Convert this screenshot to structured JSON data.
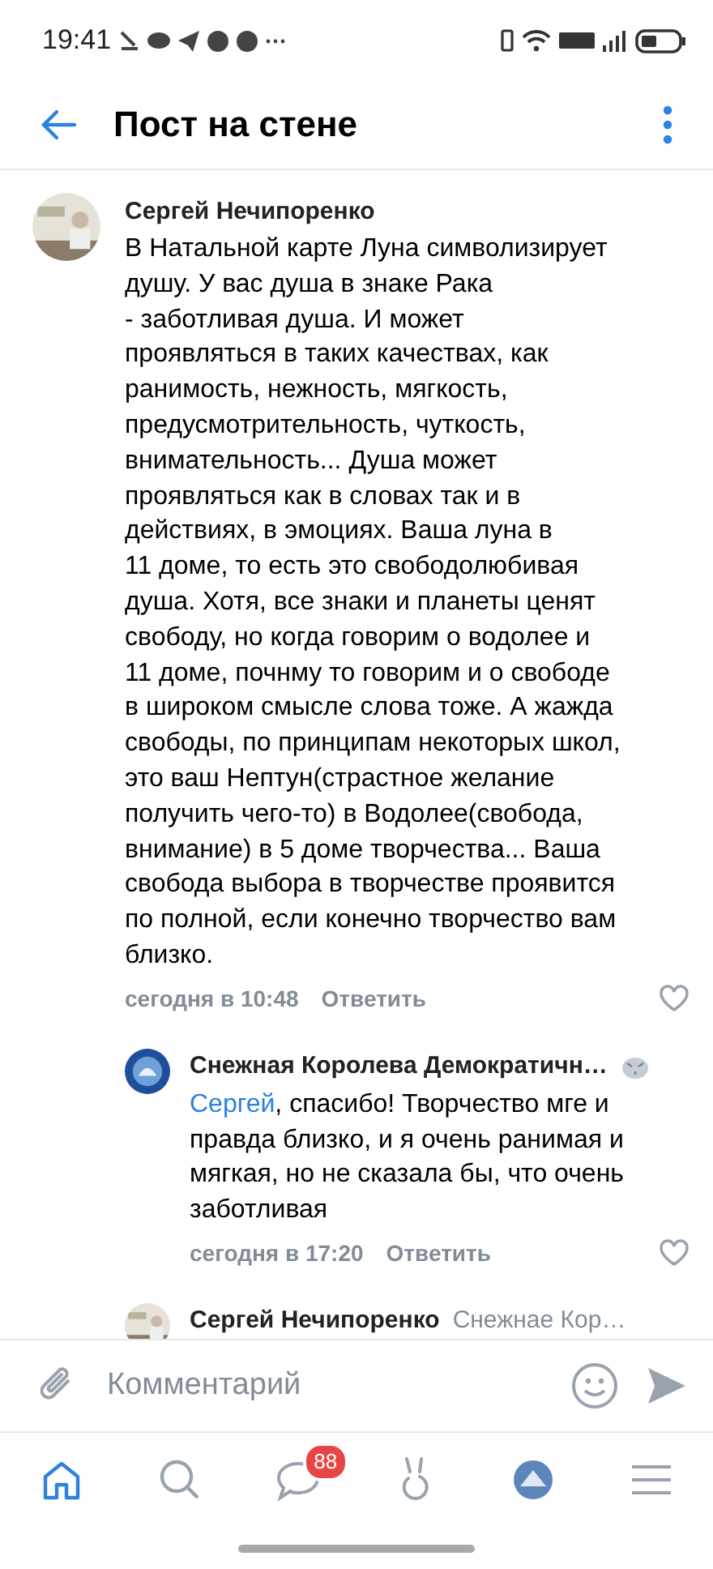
{
  "status_bar": {
    "time": "19:41"
  },
  "header": {
    "title": "Пост на стене"
  },
  "comments": [
    {
      "author": "Сергей Нечипоренко",
      "text": "В Натальной карте Луна символизирует\nдушу. У вас душа в знаке Рака\n- заботливая душа. И может\nпроявляться в таких качествах, как\nранимость, нежность, мягкость,\nпредусмотрительность, чуткость,\nвнимательность... Душа может\nпроявляться как в словах так и в\nдействиях, в эмоциях. Ваша луна в\n11 доме, то есть это свободолюбивая\nдуша. Хотя, все знаки и планеты ценят\nсвободу, но когда говорим о водолее и\n11 доме, почнму то говорим и о свободе\nв широком смысле слова тоже. А жажда\nсвободы, по принципам некоторых школ,\nэто ваш Нептун(страстное желание\nполучить чего-то) в Водолее(свобода,\nвнимание) в 5 доме творчества... Ваша\nсвобода выбора в творчестве проявится\nпо полной, если конечно творчество вам\nблизко.",
      "time": "сегодня в 10:48",
      "reply": "Ответить",
      "liked": false
    },
    {
      "author": "Снежная Королева Демократичн…",
      "mention": "Сергей",
      "text": ", спасибо! Творчество мге и\nправда близко, и я очень ранимая и\nмягкая, но не сказала бы, что очень\nзаботливая",
      "time": "сегодня в 17:20",
      "reply": "Ответить",
      "liked": false,
      "nested": true
    },
    {
      "author": "Сергей Нечипоренко",
      "reply_to": "Снежнае Кор…",
      "nested": true
    }
  ],
  "composer": {
    "placeholder": "Комментарий"
  },
  "nav": [
    {
      "kind": "home",
      "selected": true
    },
    {
      "kind": "search",
      "selected": false
    },
    {
      "kind": "messages",
      "selected": false,
      "badge": "88"
    },
    {
      "kind": "clips",
      "selected": false
    },
    {
      "kind": "avatar",
      "selected": false
    },
    {
      "kind": "menu",
      "selected": false
    }
  ]
}
